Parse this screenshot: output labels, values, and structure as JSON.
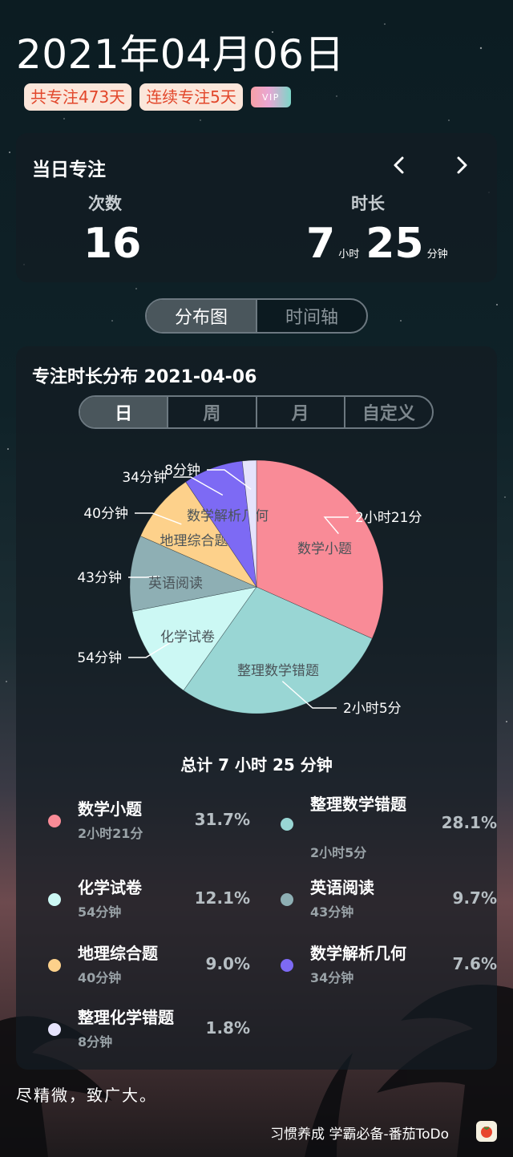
{
  "header": {
    "date": "2021年04月06日",
    "badge_total": "共专注473天",
    "badge_streak": "连续专注5天",
    "vip": "VIP"
  },
  "today": {
    "label": "当日专注",
    "count_label": "次数",
    "count": "16",
    "duration_label": "时长",
    "hours": "7",
    "hours_unit": "小时",
    "minutes": "25",
    "minutes_unit": "分钟"
  },
  "view_tabs": [
    "分布图",
    "时间轴"
  ],
  "distribution": {
    "title": "专注时长分布  2021-04-06",
    "range_tabs": [
      "日",
      "周",
      "月",
      "自定义"
    ],
    "total": "总计 7 小时 25 分钟"
  },
  "chart_data": {
    "type": "pie",
    "series": [
      {
        "name": "数学小题",
        "minutes": 141,
        "duration": "2小时21分",
        "percent": "31.7%",
        "color": "#f98b97"
      },
      {
        "name": "整理数学错题",
        "minutes": 125,
        "duration": "2小时5分",
        "percent": "28.1%",
        "color": "#99d6d4"
      },
      {
        "name": "化学试卷",
        "minutes": 54,
        "duration": "54分钟",
        "percent": "12.1%",
        "color": "#ccf8f4"
      },
      {
        "name": "英语阅读",
        "minutes": 43,
        "duration": "43分钟",
        "percent": "9.7%",
        "color": "#8eafb4"
      },
      {
        "name": "地理综合题",
        "minutes": 40,
        "duration": "40分钟",
        "percent": "9.0%",
        "color": "#fdd18b"
      },
      {
        "name": "数学解析几何",
        "minutes": 34,
        "duration": "34分钟",
        "percent": "7.6%",
        "color": "#7d6af4"
      },
      {
        "name": "整理化学错题",
        "minutes": 8,
        "duration": "8分钟",
        "percent": "1.8%",
        "color": "#e5e3fc"
      }
    ]
  },
  "quote": "尽精微，致广大。",
  "footer": "习惯养成 学霸必备-番茄ToDo"
}
